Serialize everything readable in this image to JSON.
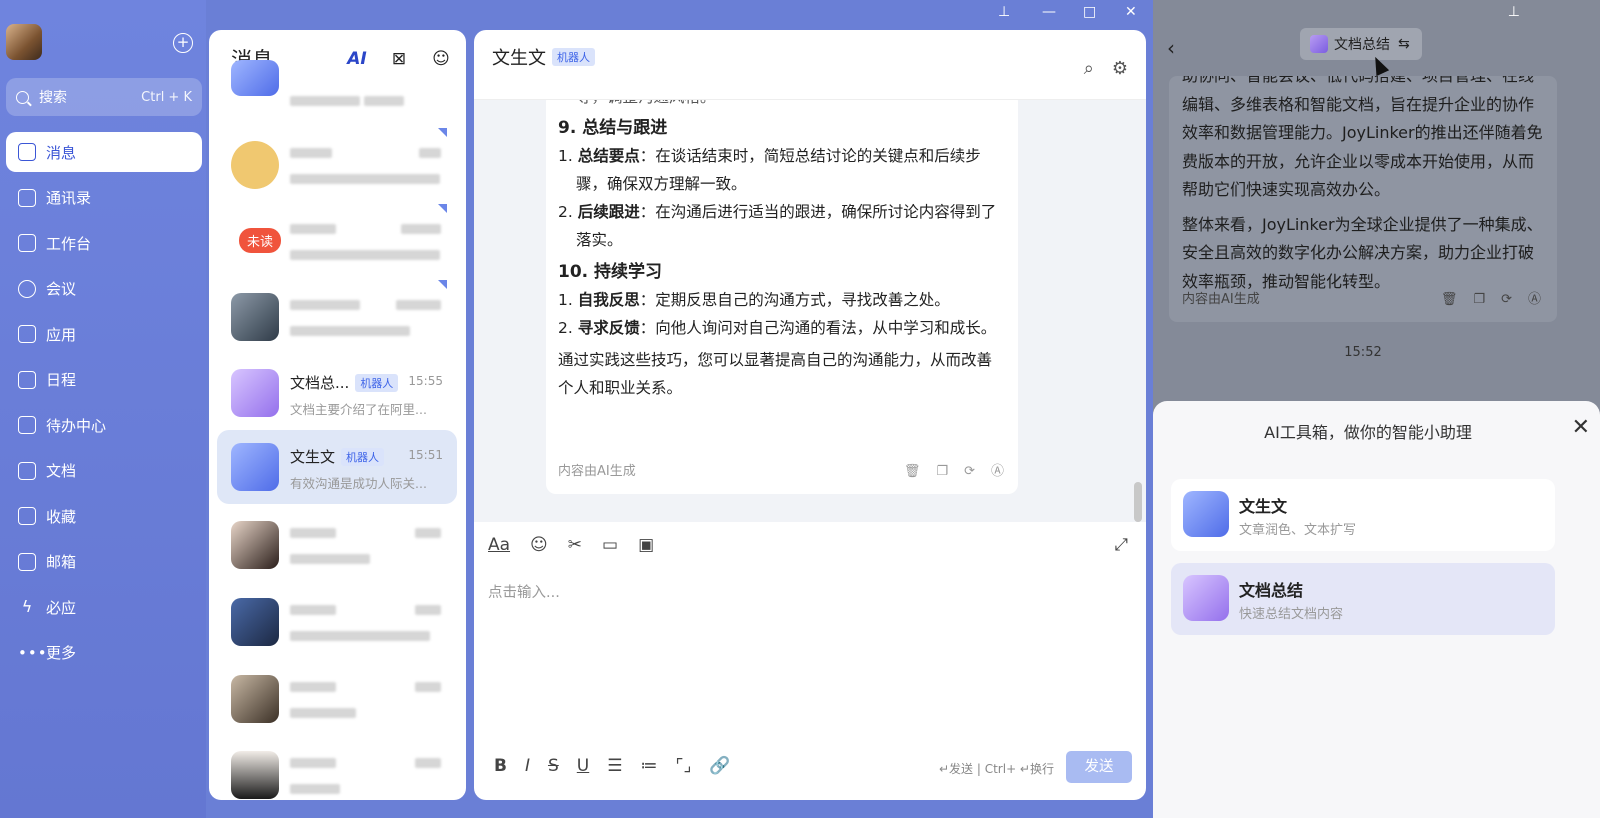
{
  "nav": {
    "search_placeholder": "搜索",
    "search_shortcut": "Ctrl + K",
    "items": [
      {
        "label": "消息",
        "icon": "message-icon"
      },
      {
        "label": "通讯录",
        "icon": "contacts-icon"
      },
      {
        "label": "工作台",
        "icon": "workbench-icon"
      },
      {
        "label": "会议",
        "icon": "meeting-icon"
      },
      {
        "label": "应用",
        "icon": "apps-icon"
      },
      {
        "label": "日程",
        "icon": "calendar-icon"
      },
      {
        "label": "待办中心",
        "icon": "todo-icon"
      },
      {
        "label": "文档",
        "icon": "document-icon"
      },
      {
        "label": "收藏",
        "icon": "favorite-icon"
      },
      {
        "label": "邮箱",
        "icon": "mail-icon"
      },
      {
        "label": "必应",
        "icon": "bolt-icon"
      },
      {
        "label": "更多",
        "icon": "more-icon"
      }
    ]
  },
  "list": {
    "title": "消息",
    "unread_badge": "未读",
    "bot_tag": "机器人",
    "items": [
      {
        "name": "文档总...",
        "time": "15:55",
        "preview": "文档主要介绍了在阿里..."
      },
      {
        "name": "文生文",
        "time": "15:51",
        "preview": "有效沟通是成功人际关..."
      }
    ]
  },
  "chat": {
    "title": "文生文",
    "tag": "机器人",
    "top_partial": "等，调整沟通风格。",
    "h9": "9. 总结与跟进",
    "i9_1_b": "总结要点",
    "i9_1": "：在谈话结束时，简短总结讨论的关键点和后续步骤，确保双方理解一致。",
    "i9_2_b": "后续跟进",
    "i9_2": "：在沟通后进行适当的跟进，确保所讨论内容得到了落实。",
    "h10": "10. 持续学习",
    "i10_1_b": "自我反思",
    "i10_1": "：定期反思自己的沟通方式，寻找改善之处。",
    "i10_2_b": "寻求反馈",
    "i10_2": "：向他人询问对自己沟通的看法，从中学习和成长。",
    "closing": "通过实践这些技巧，您可以显著提高自己的沟通能力，从而改善个人和职业关系。",
    "ai_note": "内容由AI生成",
    "input_placeholder": "点击输入...",
    "send_hint": "↵发送 | Ctrl+ ↵换行",
    "send_label": "发送"
  },
  "right": {
    "pill_label": "文档总结",
    "para1": "助协同、智能会议、低代码搭建、项目管理、在线编辑、多维表格和智能文档，旨在提升企业的协作效率和数据管理能力。JoyLinker的推出还伴随着免费版本的开放，允许企业以零成本开始使用，从而帮助它们快速实现高效办公。",
    "para2": "整体来看，JoyLinker为全球企业提供了一种集成、安全且高效的数字化办公解决方案，助力企业打破效率瓶颈，推动智能化转型。",
    "ai_note": "内容由AI生成",
    "time": "15:52"
  },
  "sheet": {
    "title": "AI工具箱，做你的智能小助理",
    "tools": [
      {
        "name": "文生文",
        "desc": "文章润色、文本扩写"
      },
      {
        "name": "文档总结",
        "desc": "快速总结文档内容"
      }
    ]
  }
}
